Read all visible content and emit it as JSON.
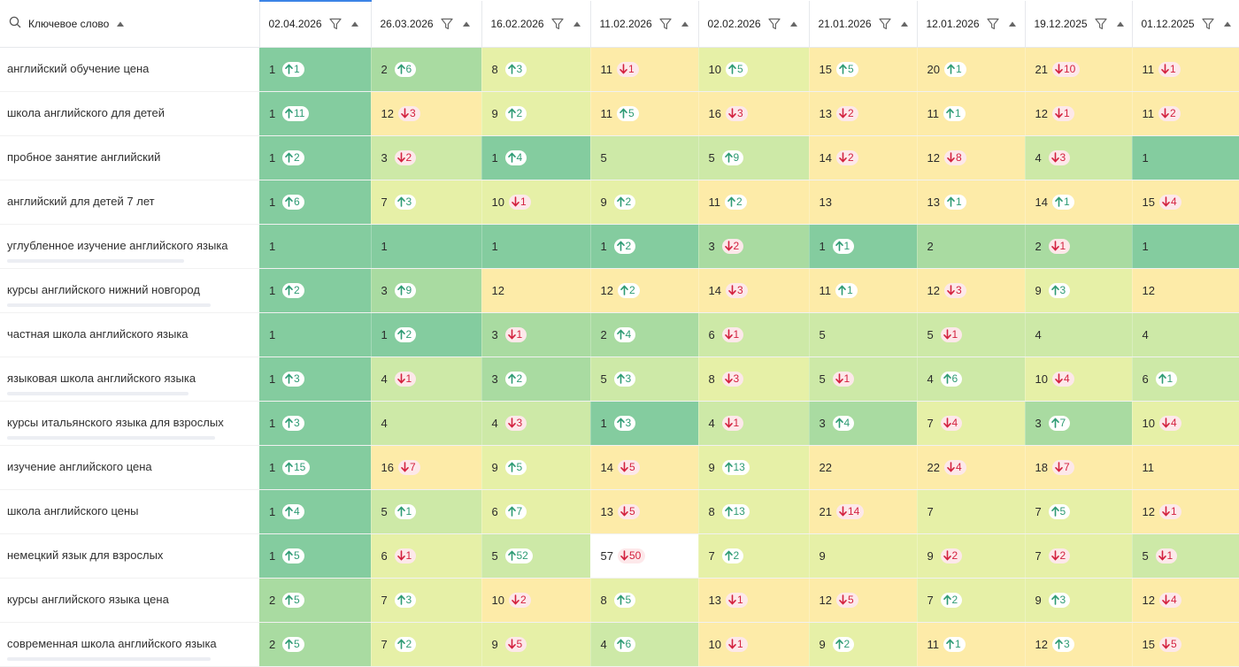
{
  "header": {
    "keyword_label": "Ключевое слово",
    "dates": [
      "02.04.2026",
      "26.03.2026",
      "16.02.2026",
      "11.02.2026",
      "02.02.2026",
      "21.01.2026",
      "12.01.2026",
      "19.12.2025",
      "01.12.2025"
    ]
  },
  "colors": {
    "accent": "#3c84e6",
    "up": "#2e9b74",
    "down": "#d3213f",
    "heat": [
      "#84cc9f",
      "#a9dba1",
      "#cde9a7",
      "#e6f0a7",
      "#fdeba8",
      "#ffffff"
    ]
  },
  "rows": [
    {
      "keyword": "английский обучение цена",
      "underline": false,
      "cells": [
        {
          "pos": "1",
          "dir": "up",
          "delta": "1",
          "heat": 0
        },
        {
          "pos": "2",
          "dir": "up",
          "delta": "6",
          "heat": 1
        },
        {
          "pos": "8",
          "dir": "up",
          "delta": "3",
          "heat": 3
        },
        {
          "pos": "11",
          "dir": "down",
          "delta": "1",
          "heat": 4
        },
        {
          "pos": "10",
          "dir": "up",
          "delta": "5",
          "heat": 3
        },
        {
          "pos": "15",
          "dir": "up",
          "delta": "5",
          "heat": 4
        },
        {
          "pos": "20",
          "dir": "up",
          "delta": "1",
          "heat": 4
        },
        {
          "pos": "21",
          "dir": "down",
          "delta": "10",
          "heat": 4
        },
        {
          "pos": "11",
          "dir": "down",
          "delta": "1",
          "heat": 4
        }
      ]
    },
    {
      "keyword": "школа английского для детей",
      "underline": false,
      "cells": [
        {
          "pos": "1",
          "dir": "up",
          "delta": "11",
          "heat": 0
        },
        {
          "pos": "12",
          "dir": "down",
          "delta": "3",
          "heat": 4
        },
        {
          "pos": "9",
          "dir": "up",
          "delta": "2",
          "heat": 3
        },
        {
          "pos": "11",
          "dir": "up",
          "delta": "5",
          "heat": 4
        },
        {
          "pos": "16",
          "dir": "down",
          "delta": "3",
          "heat": 4
        },
        {
          "pos": "13",
          "dir": "down",
          "delta": "2",
          "heat": 4
        },
        {
          "pos": "11",
          "dir": "up",
          "delta": "1",
          "heat": 4
        },
        {
          "pos": "12",
          "dir": "down",
          "delta": "1",
          "heat": 4
        },
        {
          "pos": "11",
          "dir": "down",
          "delta": "2",
          "heat": 4
        }
      ]
    },
    {
      "keyword": "пробное занятие английский",
      "underline": false,
      "cells": [
        {
          "pos": "1",
          "dir": "up",
          "delta": "2",
          "heat": 0
        },
        {
          "pos": "3",
          "dir": "down",
          "delta": "2",
          "heat": 2
        },
        {
          "pos": "1",
          "dir": "up",
          "delta": "4",
          "heat": 0
        },
        {
          "pos": "5",
          "dir": "",
          "delta": "",
          "heat": 2
        },
        {
          "pos": "5",
          "dir": "up",
          "delta": "9",
          "heat": 2
        },
        {
          "pos": "14",
          "dir": "down",
          "delta": "2",
          "heat": 4
        },
        {
          "pos": "12",
          "dir": "down",
          "delta": "8",
          "heat": 4
        },
        {
          "pos": "4",
          "dir": "down",
          "delta": "3",
          "heat": 2
        },
        {
          "pos": "1",
          "dir": "",
          "delta": "",
          "heat": 0
        }
      ]
    },
    {
      "keyword": "английский для детей 7 лет",
      "underline": false,
      "cells": [
        {
          "pos": "1",
          "dir": "up",
          "delta": "6",
          "heat": 0
        },
        {
          "pos": "7",
          "dir": "up",
          "delta": "3",
          "heat": 3
        },
        {
          "pos": "10",
          "dir": "down",
          "delta": "1",
          "heat": 3
        },
        {
          "pos": "9",
          "dir": "up",
          "delta": "2",
          "heat": 3
        },
        {
          "pos": "11",
          "dir": "up",
          "delta": "2",
          "heat": 4
        },
        {
          "pos": "13",
          "dir": "",
          "delta": "",
          "heat": 4
        },
        {
          "pos": "13",
          "dir": "up",
          "delta": "1",
          "heat": 4
        },
        {
          "pos": "14",
          "dir": "up",
          "delta": "1",
          "heat": 4
        },
        {
          "pos": "15",
          "dir": "down",
          "delta": "4",
          "heat": 4
        }
      ]
    },
    {
      "keyword": "углубленное изучение английского языка",
      "underline": true,
      "cells": [
        {
          "pos": "1",
          "dir": "",
          "delta": "",
          "heat": 0
        },
        {
          "pos": "1",
          "dir": "",
          "delta": "",
          "heat": 0
        },
        {
          "pos": "1",
          "dir": "",
          "delta": "",
          "heat": 0
        },
        {
          "pos": "1",
          "dir": "up",
          "delta": "2",
          "heat": 0
        },
        {
          "pos": "3",
          "dir": "down",
          "delta": "2",
          "heat": 1
        },
        {
          "pos": "1",
          "dir": "up",
          "delta": "1",
          "heat": 0
        },
        {
          "pos": "2",
          "dir": "",
          "delta": "",
          "heat": 1
        },
        {
          "pos": "2",
          "dir": "down",
          "delta": "1",
          "heat": 1
        },
        {
          "pos": "1",
          "dir": "",
          "delta": "",
          "heat": 0
        }
      ]
    },
    {
      "keyword": "курсы английского нижний новгород",
      "underline": true,
      "cells": [
        {
          "pos": "1",
          "dir": "up",
          "delta": "2",
          "heat": 0
        },
        {
          "pos": "3",
          "dir": "up",
          "delta": "9",
          "heat": 1
        },
        {
          "pos": "12",
          "dir": "",
          "delta": "",
          "heat": 4
        },
        {
          "pos": "12",
          "dir": "up",
          "delta": "2",
          "heat": 4
        },
        {
          "pos": "14",
          "dir": "down",
          "delta": "3",
          "heat": 4
        },
        {
          "pos": "11",
          "dir": "up",
          "delta": "1",
          "heat": 4
        },
        {
          "pos": "12",
          "dir": "down",
          "delta": "3",
          "heat": 4
        },
        {
          "pos": "9",
          "dir": "up",
          "delta": "3",
          "heat": 3
        },
        {
          "pos": "12",
          "dir": "",
          "delta": "",
          "heat": 4
        }
      ]
    },
    {
      "keyword": "частная школа английского языка",
      "underline": false,
      "cells": [
        {
          "pos": "1",
          "dir": "",
          "delta": "",
          "heat": 0
        },
        {
          "pos": "1",
          "dir": "up",
          "delta": "2",
          "heat": 0
        },
        {
          "pos": "3",
          "dir": "down",
          "delta": "1",
          "heat": 1
        },
        {
          "pos": "2",
          "dir": "up",
          "delta": "4",
          "heat": 1
        },
        {
          "pos": "6",
          "dir": "down",
          "delta": "1",
          "heat": 2
        },
        {
          "pos": "5",
          "dir": "",
          "delta": "",
          "heat": 2
        },
        {
          "pos": "5",
          "dir": "down",
          "delta": "1",
          "heat": 2
        },
        {
          "pos": "4",
          "dir": "",
          "delta": "",
          "heat": 2
        },
        {
          "pos": "4",
          "dir": "",
          "delta": "",
          "heat": 2
        }
      ]
    },
    {
      "keyword": "языковая школа английского языка",
      "underline": true,
      "cells": [
        {
          "pos": "1",
          "dir": "up",
          "delta": "3",
          "heat": 0
        },
        {
          "pos": "4",
          "dir": "down",
          "delta": "1",
          "heat": 2
        },
        {
          "pos": "3",
          "dir": "up",
          "delta": "2",
          "heat": 1
        },
        {
          "pos": "5",
          "dir": "up",
          "delta": "3",
          "heat": 2
        },
        {
          "pos": "8",
          "dir": "down",
          "delta": "3",
          "heat": 3
        },
        {
          "pos": "5",
          "dir": "down",
          "delta": "1",
          "heat": 2
        },
        {
          "pos": "4",
          "dir": "up",
          "delta": "6",
          "heat": 2
        },
        {
          "pos": "10",
          "dir": "down",
          "delta": "4",
          "heat": 3
        },
        {
          "pos": "6",
          "dir": "up",
          "delta": "1",
          "heat": 2
        }
      ]
    },
    {
      "keyword": "курсы итальянского языка для взрослых",
      "underline": true,
      "cells": [
        {
          "pos": "1",
          "dir": "up",
          "delta": "3",
          "heat": 0
        },
        {
          "pos": "4",
          "dir": "",
          "delta": "",
          "heat": 2
        },
        {
          "pos": "4",
          "dir": "down",
          "delta": "3",
          "heat": 2
        },
        {
          "pos": "1",
          "dir": "up",
          "delta": "3",
          "heat": 0
        },
        {
          "pos": "4",
          "dir": "down",
          "delta": "1",
          "heat": 2
        },
        {
          "pos": "3",
          "dir": "up",
          "delta": "4",
          "heat": 1
        },
        {
          "pos": "7",
          "dir": "down",
          "delta": "4",
          "heat": 3
        },
        {
          "pos": "3",
          "dir": "up",
          "delta": "7",
          "heat": 1
        },
        {
          "pos": "10",
          "dir": "down",
          "delta": "4",
          "heat": 3
        }
      ]
    },
    {
      "keyword": "изучение английского цена",
      "underline": false,
      "cells": [
        {
          "pos": "1",
          "dir": "up",
          "delta": "15",
          "heat": 0
        },
        {
          "pos": "16",
          "dir": "down",
          "delta": "7",
          "heat": 4
        },
        {
          "pos": "9",
          "dir": "up",
          "delta": "5",
          "heat": 3
        },
        {
          "pos": "14",
          "dir": "down",
          "delta": "5",
          "heat": 4
        },
        {
          "pos": "9",
          "dir": "up",
          "delta": "13",
          "heat": 3
        },
        {
          "pos": "22",
          "dir": "",
          "delta": "",
          "heat": 4
        },
        {
          "pos": "22",
          "dir": "down",
          "delta": "4",
          "heat": 4
        },
        {
          "pos": "18",
          "dir": "down",
          "delta": "7",
          "heat": 4
        },
        {
          "pos": "11",
          "dir": "",
          "delta": "",
          "heat": 4
        }
      ]
    },
    {
      "keyword": "школа английского цены",
      "underline": false,
      "cells": [
        {
          "pos": "1",
          "dir": "up",
          "delta": "4",
          "heat": 0
        },
        {
          "pos": "5",
          "dir": "up",
          "delta": "1",
          "heat": 2
        },
        {
          "pos": "6",
          "dir": "up",
          "delta": "7",
          "heat": 3
        },
        {
          "pos": "13",
          "dir": "down",
          "delta": "5",
          "heat": 4
        },
        {
          "pos": "8",
          "dir": "up",
          "delta": "13",
          "heat": 3
        },
        {
          "pos": "21",
          "dir": "down",
          "delta": "14",
          "heat": 4
        },
        {
          "pos": "7",
          "dir": "",
          "delta": "",
          "heat": 3
        },
        {
          "pos": "7",
          "dir": "up",
          "delta": "5",
          "heat": 3
        },
        {
          "pos": "12",
          "dir": "down",
          "delta": "1",
          "heat": 4
        }
      ]
    },
    {
      "keyword": "немецкий язык для взрослых",
      "underline": false,
      "cells": [
        {
          "pos": "1",
          "dir": "up",
          "delta": "5",
          "heat": 0
        },
        {
          "pos": "6",
          "dir": "down",
          "delta": "1",
          "heat": 3
        },
        {
          "pos": "5",
          "dir": "up",
          "delta": "52",
          "heat": 2
        },
        {
          "pos": "57",
          "dir": "down",
          "delta": "50",
          "heat": 5
        },
        {
          "pos": "7",
          "dir": "up",
          "delta": "2",
          "heat": 3
        },
        {
          "pos": "9",
          "dir": "",
          "delta": "",
          "heat": 3
        },
        {
          "pos": "9",
          "dir": "down",
          "delta": "2",
          "heat": 3
        },
        {
          "pos": "7",
          "dir": "down",
          "delta": "2",
          "heat": 3
        },
        {
          "pos": "5",
          "dir": "down",
          "delta": "1",
          "heat": 2
        }
      ]
    },
    {
      "keyword": "курсы английского языка цена",
      "underline": false,
      "cells": [
        {
          "pos": "2",
          "dir": "up",
          "delta": "5",
          "heat": 1
        },
        {
          "pos": "7",
          "dir": "up",
          "delta": "3",
          "heat": 3
        },
        {
          "pos": "10",
          "dir": "down",
          "delta": "2",
          "heat": 4
        },
        {
          "pos": "8",
          "dir": "up",
          "delta": "5",
          "heat": 3
        },
        {
          "pos": "13",
          "dir": "down",
          "delta": "1",
          "heat": 4
        },
        {
          "pos": "12",
          "dir": "down",
          "delta": "5",
          "heat": 4
        },
        {
          "pos": "7",
          "dir": "up",
          "delta": "2",
          "heat": 3
        },
        {
          "pos": "9",
          "dir": "up",
          "delta": "3",
          "heat": 3
        },
        {
          "pos": "12",
          "dir": "down",
          "delta": "4",
          "heat": 4
        }
      ]
    },
    {
      "keyword": "современная школа английского языка",
      "underline": true,
      "cells": [
        {
          "pos": "2",
          "dir": "up",
          "delta": "5",
          "heat": 1
        },
        {
          "pos": "7",
          "dir": "up",
          "delta": "2",
          "heat": 3
        },
        {
          "pos": "9",
          "dir": "down",
          "delta": "5",
          "heat": 3
        },
        {
          "pos": "4",
          "dir": "up",
          "delta": "6",
          "heat": 2
        },
        {
          "pos": "10",
          "dir": "down",
          "delta": "1",
          "heat": 4
        },
        {
          "pos": "9",
          "dir": "up",
          "delta": "2",
          "heat": 3
        },
        {
          "pos": "11",
          "dir": "up",
          "delta": "1",
          "heat": 4
        },
        {
          "pos": "12",
          "dir": "up",
          "delta": "3",
          "heat": 4
        },
        {
          "pos": "15",
          "dir": "down",
          "delta": "5",
          "heat": 4
        }
      ]
    }
  ]
}
